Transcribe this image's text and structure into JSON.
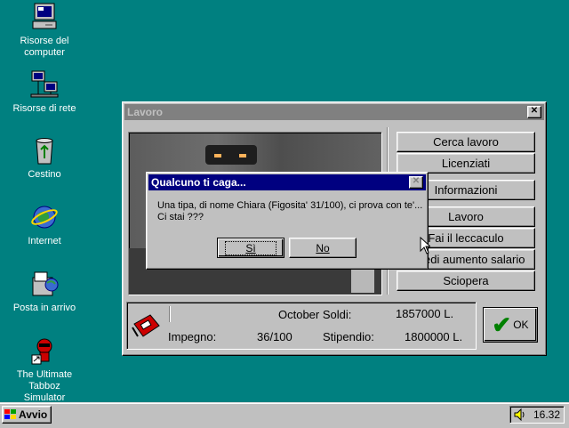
{
  "desktop": {
    "icons": [
      {
        "label_line1": "Risorse del",
        "label_line2": "computer",
        "icon": "my-computer-icon"
      },
      {
        "label_line1": "Risorse di rete",
        "label_line2": "",
        "icon": "network-icon"
      },
      {
        "label_line1": "Cestino",
        "label_line2": "",
        "icon": "recycle-bin-icon"
      },
      {
        "label_line1": "Internet",
        "label_line2": "",
        "icon": "internet-explorer-icon"
      },
      {
        "label_line1": "Posta in arrivo",
        "label_line2": "",
        "icon": "inbox-icon"
      },
      {
        "label_line1": "The Ultimate",
        "label_line2": "Tabboz Simulator",
        "icon": "tabboz-icon"
      }
    ]
  },
  "main_window": {
    "title": "Lavoro",
    "buttons": [
      "Cerca lavoro",
      "Licenziati",
      "Informazioni",
      "Lavoro",
      "Fai il leccaculo",
      "Chiedi aumento salario",
      "Sciopera"
    ],
    "status": {
      "month_label": "October Soldi:",
      "soldi_value": "1857000 L.",
      "impegno_label": "Impegno:",
      "impegno_value": "36/100",
      "stipendio_label": "Stipendio:",
      "stipendio_value": "1800000 L."
    },
    "ok_label": "OK"
  },
  "dialog": {
    "title": "Qualcuno ti caga...",
    "message_line1": "Una tipa, di nome Chiara (Figosita' 31/100), ci prova con te'...",
    "message_line2": "Ci stai ???",
    "yes_label": "Sì",
    "no_label": "No"
  },
  "taskbar": {
    "start_label": "Avvio",
    "clock": "16.32"
  },
  "colors": {
    "desktop": "#008080",
    "active_title": "#000080",
    "inactive_title": "#808080",
    "face": "#c0c0c0"
  }
}
